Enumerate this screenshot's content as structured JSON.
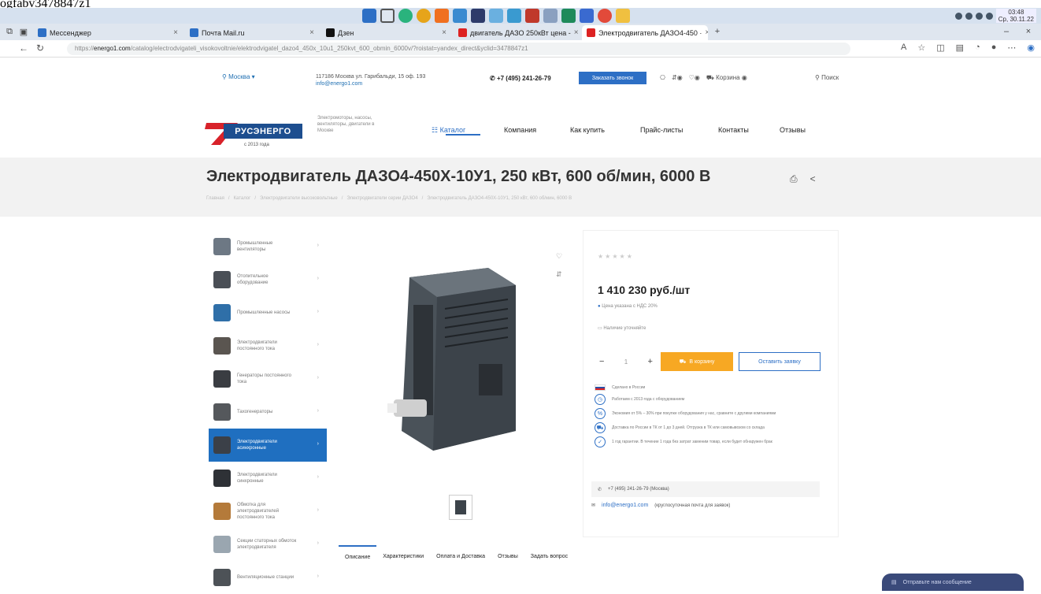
{
  "overlay_text": "ogfabv3478847z1",
  "browser": {
    "tabs": [
      {
        "label": "Мессенджер",
        "color": "#2d6fc5"
      },
      {
        "label": "Почта Mail.ru",
        "color": "#2d6fc5"
      },
      {
        "label": "Дзен",
        "color": "#111111"
      },
      {
        "label": "двигатель ДАЗО 250кВт цена - ",
        "color": "#d22222"
      },
      {
        "label": "Электродвигатель ДАЗО4-450 ·",
        "color": "#d22222"
      }
    ],
    "url_prefix": "https://",
    "url_host": "energo1.com",
    "url_path": "/catalog/electrodvigateli_visokovoltnie/elektrodvigatel_dazo4_450x_10u1_250kvt_600_obmin_6000v/?roistat=yandex_direct&yclid=3478847z1",
    "tray_time": "03:48",
    "tray_date": "Ср, 30.11.22"
  },
  "header": {
    "city": "Москва",
    "address": "117186 Москва ул. Гарибальди, 15 оф. 193",
    "email": "info@energo1.com",
    "phone": "+7 (495) 241-26-79",
    "callback_label": "Заказать звонок",
    "cart_label": "Корзина",
    "search_label": "Поиск"
  },
  "logo": {
    "name": "РУСЭНЕРГО",
    "since": "с 2013 года",
    "tagline": "Электромоторы, насосы, вентиляторы, двигатели в Москве"
  },
  "nav": {
    "items": [
      "Каталог",
      "Компания",
      "Как купить",
      "Прайс-листы",
      "Контакты",
      "Отзывы"
    ]
  },
  "product": {
    "title": "Электродвигатель ДАЗО4-450Х-10У1, 250 кВт, 600 об/мин, 6000 В",
    "breadcrumbs": [
      "Главная",
      "/",
      "Каталог",
      "/",
      "Электродвигатели высоковольтные",
      "/",
      "Электродвигатели серии ДАЗО4",
      "/",
      "Электродвигатель ДАЗО4-450Х-10У1, 250 кВт, 600 об/мин, 6000 В"
    ],
    "price": "1 410 230 руб./шт",
    "price_note": "Цена указана с НДС 20%",
    "compare_label": "Наличие уточняйте",
    "qty": "1",
    "cart_button": "В корзину",
    "order_button": "Оставить заявку",
    "features": [
      "Сделано в России",
      "Работаем с 2013 года с оборудованием",
      "Экономия от 5% – 30% при покупке оборудования у нас, сравните с другими компаниями",
      "Доставка по России в ТК от 1 до 3 дней. Отгрузка в ТК или самовывозом со склада",
      "1 год гарантии. В течение 1 года без затрат заменим товар, если будет обнаружен брак"
    ],
    "contact_phone": "+7 (495) 241-26-79 (Москва)",
    "contact_email": "info@energo1.com",
    "contact_email_note": "(круглосуточная почта для заявок)"
  },
  "sidebar": {
    "items": [
      {
        "label": "Промышленные вентиляторы",
        "color": "#6d7884",
        "active": false
      },
      {
        "label": "Отопительное оборудование",
        "color": "#4a4f56",
        "active": false
      },
      {
        "label": "Промышленные насосы",
        "color": "#2f6fa8",
        "active": false
      },
      {
        "label": "Электродвигатели постоянного тока",
        "color": "#5a5550",
        "active": false
      },
      {
        "label": "Генераторы постоянного тока",
        "color": "#3a3d42",
        "active": false
      },
      {
        "label": "Тахогенераторы",
        "color": "#55585c",
        "active": false
      },
      {
        "label": "Электродвигатели асинхронные",
        "color": "#3b4048",
        "active": true
      },
      {
        "label": "Электродвигатели синхронные",
        "color": "#2e3136",
        "active": false
      },
      {
        "label": "Обмотка для электродвигателей постоянного тока",
        "color": "#b47a3a",
        "active": false
      },
      {
        "label": "Секции статорных обмоток электродвигателя",
        "color": "#9aa6b0",
        "active": false
      },
      {
        "label": "Вентиляционные станции",
        "color": "#4d5257",
        "active": false
      }
    ]
  },
  "tabs": [
    "Описание",
    "Характеристики",
    "Оплата и Доставка",
    "Отзывы",
    "Задать вопрос"
  ],
  "chat": {
    "label": "Отправьте нам сообщение"
  },
  "colors": {
    "accent": "#2d6fc5",
    "cart": "#f7a823",
    "brand": "#1d4e8f",
    "logo_red": "#d8222a"
  }
}
